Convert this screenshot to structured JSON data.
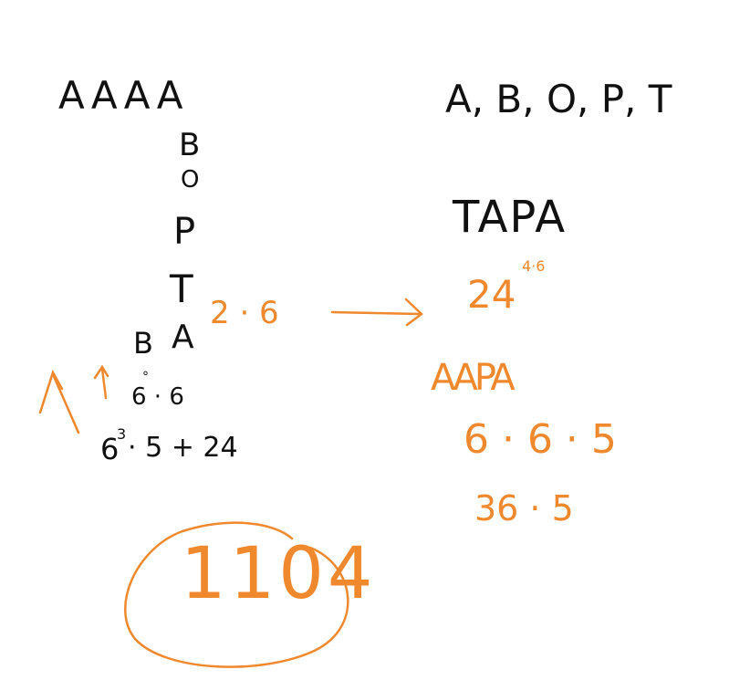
{
  "colors": {
    "ink_black": "#111111",
    "ink_orange": "#f0882e",
    "background": "#ffffff"
  },
  "left": {
    "row_top": "AAAA",
    "column": [
      "B",
      "O",
      "P",
      "T",
      "A"
    ],
    "letter_b_left": "B",
    "multiplier_orange": "2 · 6",
    "small_mark": "°",
    "product": "6 · 6",
    "expression_base": "6",
    "expression_exp": "3",
    "expression_rest": "· 5 + 24"
  },
  "right": {
    "letters_list": "A, B, O, P, T",
    "word_black": "TAPA",
    "count_base": "24",
    "count_note": "4·6",
    "word_orange": "AAPA",
    "product_line": "6 · 6 · 5",
    "result_line": "36 · 5"
  },
  "answer": "1104"
}
